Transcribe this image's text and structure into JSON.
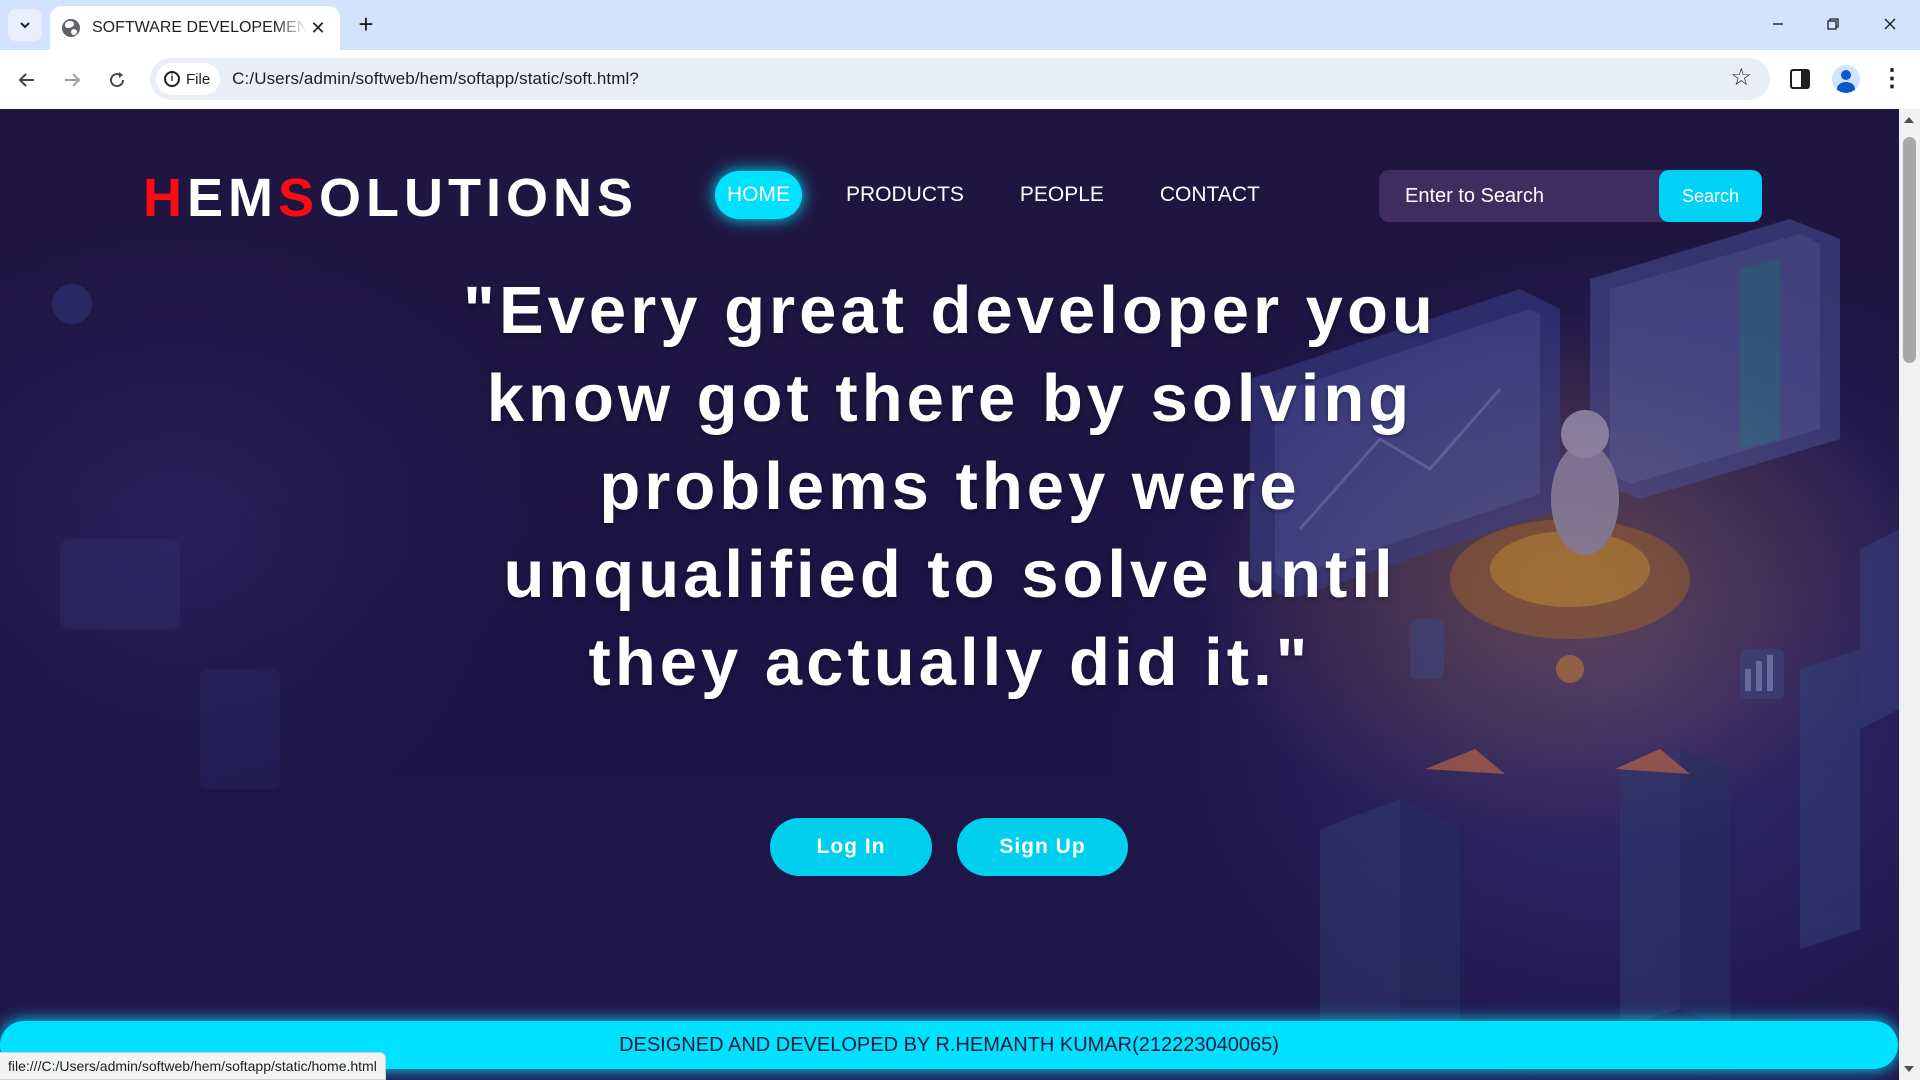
{
  "browser": {
    "tab_title": "SOFTWARE DEVELOPEMENT C",
    "url_chip": "File",
    "url": "C:/Users/admin/softweb/hem/softapp/static/soft.html?",
    "status_url": "file:///C:/Users/admin/softweb/hem/softapp/static/home.html"
  },
  "brand": {
    "part1": "H",
    "part2": "EM",
    "part3": "S",
    "part4": "OLUTIONS"
  },
  "nav": {
    "items": [
      {
        "label": "HOME",
        "active": true
      },
      {
        "label": "PRODUCTS"
      },
      {
        "label": "PEOPLE"
      },
      {
        "label": "CONTACT"
      }
    ]
  },
  "search": {
    "placeholder": "Enter to Search",
    "button_label": "Search"
  },
  "hero": {
    "quote": "\"Every great developer you know got there by solving problems they were unqualified to solve until they actually did it.\"",
    "login_label": "Log In",
    "signup_label": "Sign Up"
  },
  "footer": {
    "text": "DESIGNED AND DEVELOPED BY R.HEMANTH KUMAR(212223040065)"
  },
  "colors": {
    "accent": "#00e1ff",
    "brand_red": "#ff0a12",
    "background": "#1f1640"
  }
}
